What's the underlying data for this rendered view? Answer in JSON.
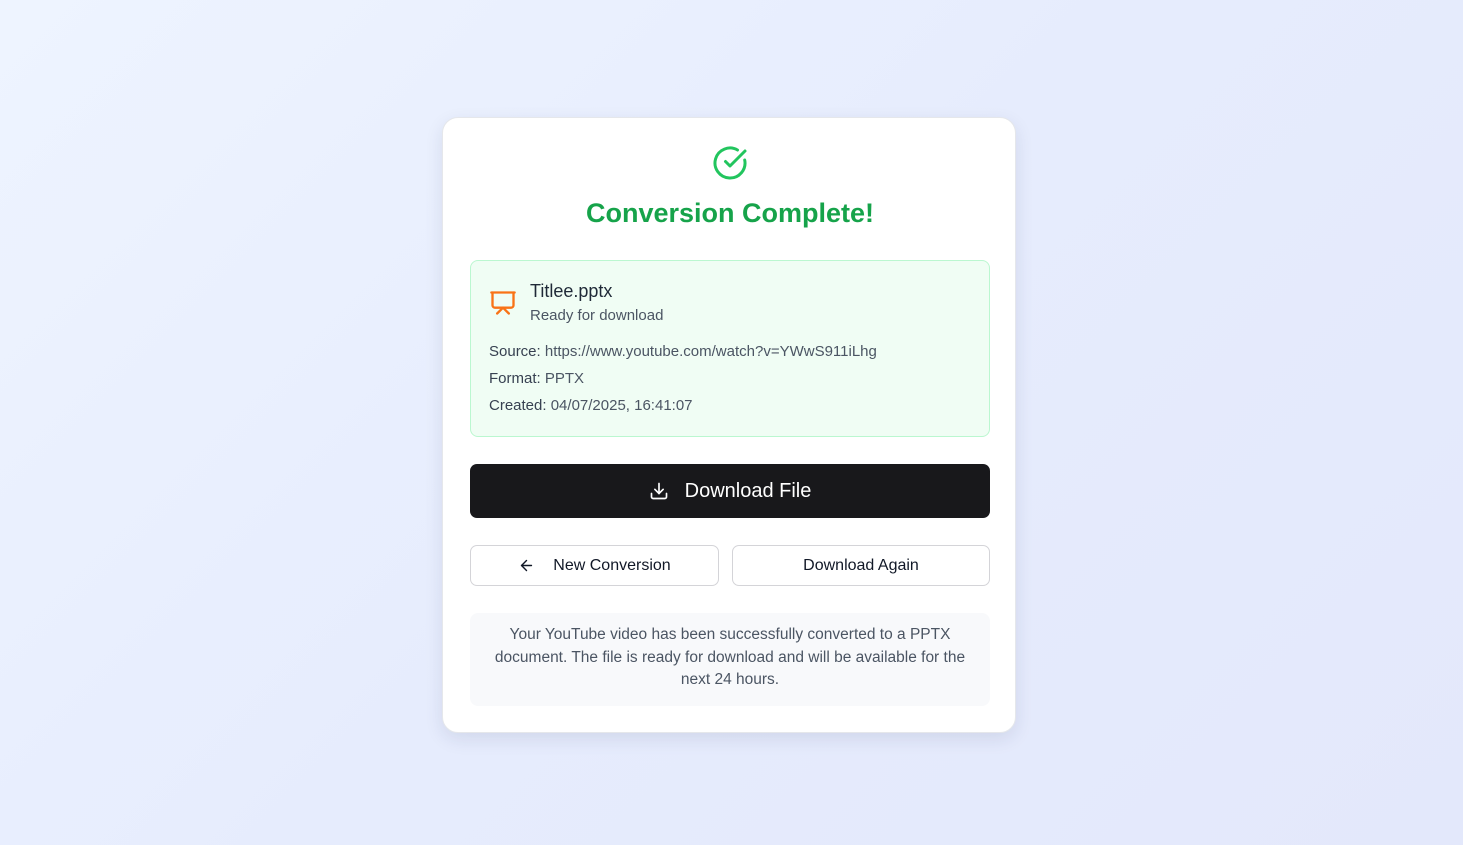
{
  "status": {
    "title": "Conversion Complete!",
    "icon": "check-circle-icon",
    "color": "#16a34a"
  },
  "file": {
    "icon": "presentation-icon",
    "icon_color": "#f97316",
    "name": "Titlee.pptx",
    "status": "Ready for download",
    "source_label": "Source:",
    "source_value": "https://www.youtube.com/watch?v=YWwS911iLhg",
    "format_label": "Format:",
    "format_value": "PPTX",
    "created_label": "Created:",
    "created_value": "04/07/2025, 16:41:07"
  },
  "actions": {
    "download_label": "Download File",
    "new_conversion_label": "New Conversion",
    "download_again_label": "Download Again"
  },
  "note": {
    "text": "Your YouTube video has been successfully converted to a PPTX document. The file is ready for download and will be available for the next 24 hours."
  }
}
